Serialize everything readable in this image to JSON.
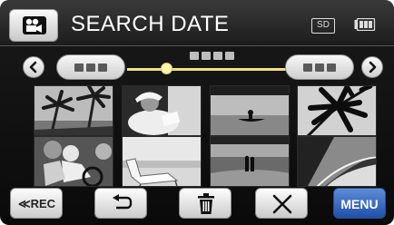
{
  "header": {
    "mode_icon": "video-camera-icon",
    "title": "SEARCH DATE",
    "media_label": "SD",
    "battery_icon": "battery-icon"
  },
  "date_nav": {
    "prev_icon": "chevron-left-icon",
    "next_icon": "chevron-right-icon"
  },
  "thumbnails": [
    {
      "name": "palm-trees"
    },
    {
      "name": "woman-reading"
    },
    {
      "name": "canoe-on-lake"
    },
    {
      "name": "palm-leaves"
    },
    {
      "name": "cyclists"
    },
    {
      "name": "beach-chair"
    },
    {
      "name": "couple-on-beach"
    },
    {
      "name": "shoreline-waves"
    }
  ],
  "bottom_bar": {
    "rec_label": "≪REC",
    "back_icon": "return-arrow-icon",
    "delete_icon": "trash-icon",
    "close_icon": "close-icon",
    "menu_label": "MENU"
  },
  "colors": {
    "accent_slider": "#f0e08a",
    "menu_button": "#2f5fb8"
  }
}
